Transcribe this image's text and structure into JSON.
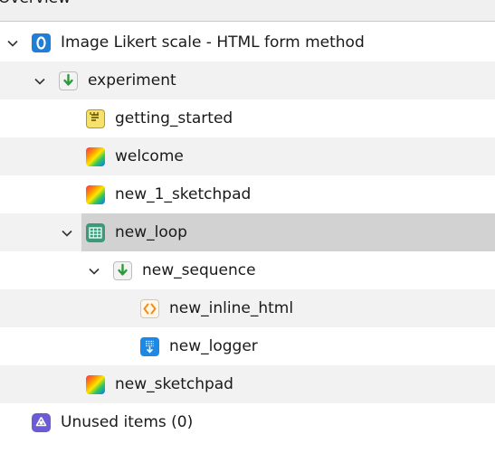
{
  "panel": {
    "title": "Overview"
  },
  "tree": {
    "root": {
      "label": "Image Likert scale - HTML form method",
      "icon": "osweb-icon"
    },
    "experiment": {
      "label": "experiment",
      "icon": "sequence-icon"
    },
    "getting_started": {
      "label": "getting_started",
      "icon": "notepad-icon"
    },
    "welcome": {
      "label": "welcome",
      "icon": "sketchpad-icon"
    },
    "new_1_sketchpad": {
      "label": "new_1_sketchpad",
      "icon": "sketchpad-icon"
    },
    "new_loop": {
      "label": "new_loop",
      "icon": "loop-icon",
      "selected": true
    },
    "new_sequence": {
      "label": "new_sequence",
      "icon": "sequence-icon"
    },
    "new_inline_html": {
      "label": "new_inline_html",
      "icon": "inline-html-icon"
    },
    "new_logger": {
      "label": "new_logger",
      "icon": "logger-icon"
    },
    "new_sketchpad": {
      "label": "new_sketchpad",
      "icon": "sketchpad-icon"
    },
    "unused": {
      "label": "Unused items (0)",
      "icon": "unused-items-icon"
    }
  },
  "colors": {
    "selected_row": "#d2d2d2",
    "alt_row": "#f2f2f2",
    "header_bg": "#f0f0f0"
  }
}
